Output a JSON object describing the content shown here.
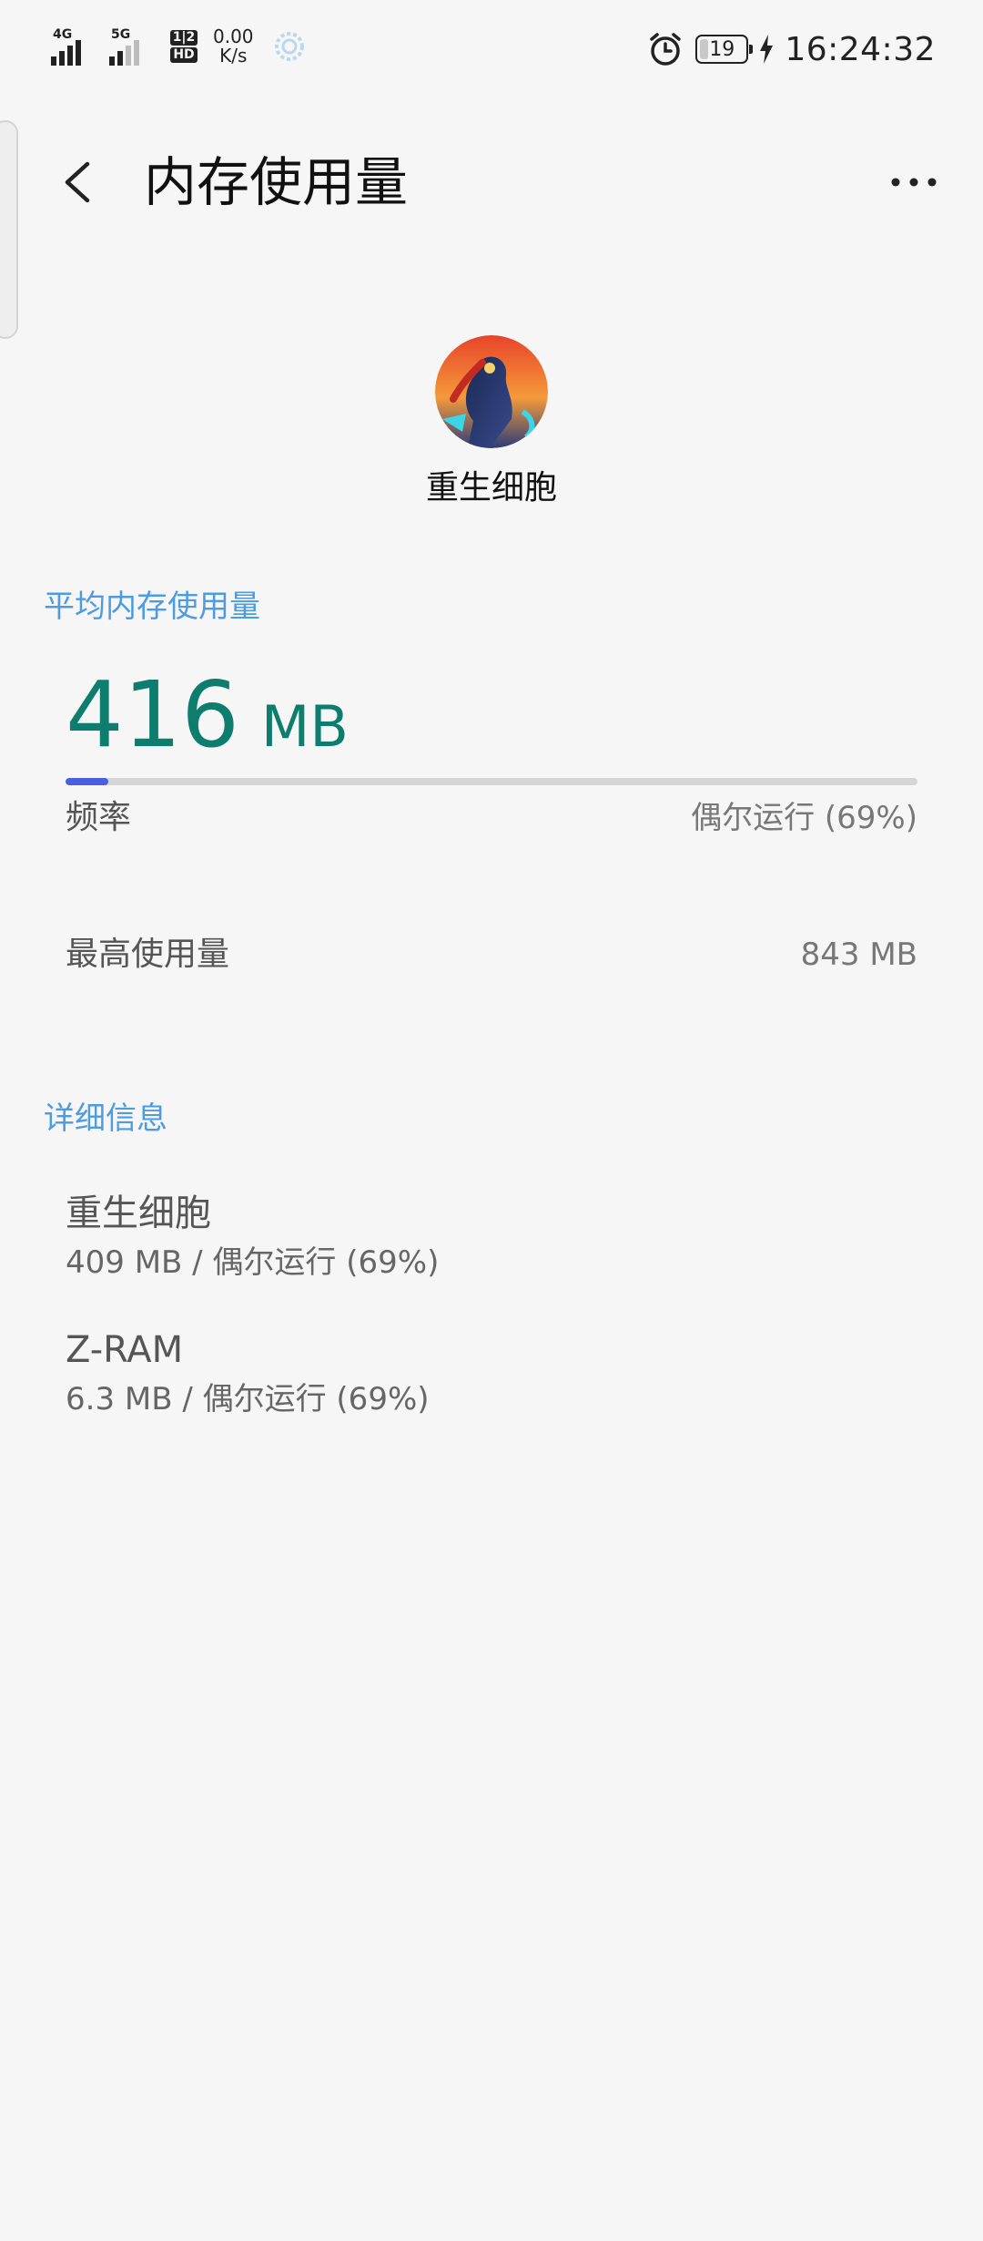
{
  "status_bar": {
    "signal_1_label": "4G",
    "signal_2_label": "5G",
    "hd_top": "1|2",
    "hd_bottom": "HD",
    "net_speed_value": "0.00",
    "net_speed_unit": "K/s",
    "battery_level": "19",
    "time": "16:24:32",
    "icons": [
      "signal-4g-icon",
      "signal-5g-icon",
      "hd-volte-icon",
      "spinner-icon",
      "alarm-clock-icon",
      "battery-icon",
      "charging-bolt-icon"
    ]
  },
  "header": {
    "back_icon": "chevron-left-icon",
    "title": "内存使用量",
    "more_icon": "more-horizontal-icon"
  },
  "app": {
    "name": "重生细胞"
  },
  "average_section": {
    "header": "平均内存使用量",
    "value": "416",
    "unit": "MB",
    "usage_fraction": 0.05,
    "frequency_label": "频率",
    "frequency_value": "偶尔运行 (69%)",
    "peak_label": "最高使用量",
    "peak_value": "843 MB"
  },
  "details_section": {
    "header": "详细信息",
    "items": [
      {
        "title": "重生细胞",
        "subtitle": "409 MB / 偶尔运行 (69%)"
      },
      {
        "title": "Z-RAM",
        "subtitle": "6.3 MB / 偶尔运行 (69%)"
      }
    ]
  },
  "colors": {
    "background": "#f6f6f6",
    "accent_section": "#4e9be0",
    "value_green": "#0d7e6e",
    "progress_fill": "#4a5fe0",
    "progress_track": "#d6d6d6"
  }
}
